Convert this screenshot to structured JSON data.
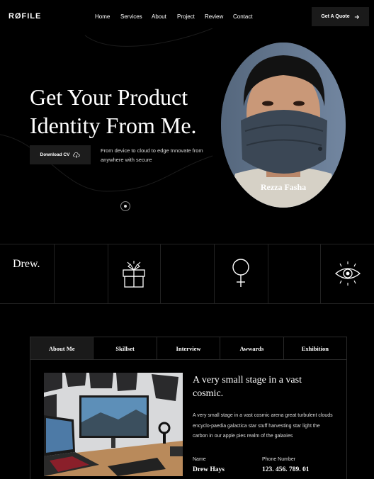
{
  "brand": {
    "logo": "RØFILE"
  },
  "nav": {
    "items": [
      "Home",
      "Services",
      "About",
      "Project",
      "Review",
      "Contact"
    ],
    "cta_label": "Get A Quote"
  },
  "hero": {
    "title": "Get Your Product Identity From Me.",
    "download_label": "Download CV",
    "subtitle": "From device to cloud to edge Innovate from anywhere with secure",
    "portrait_name": "Rezza Fasha"
  },
  "features": {
    "signature": "Drew.",
    "icons": [
      "gift-box-icon",
      "female-symbol-icon",
      "eye-icon"
    ]
  },
  "tabs": {
    "items": [
      "About Me",
      "Skillset",
      "Interview",
      "Awwards",
      "Exhibition"
    ],
    "active": "About Me"
  },
  "about": {
    "title": "A very small stage in a vast cosmic.",
    "body": "A very small stage in a vast cosmic arena great turbulent clouds encyclo-paedia galactica star stuff harvesting star light the carbon in our apple pies realm of the galaxies",
    "name_label": "Name",
    "name_value": "Drew Hays",
    "phone_label": "Phone Number",
    "phone_value": "123. 456. 789. 01"
  }
}
